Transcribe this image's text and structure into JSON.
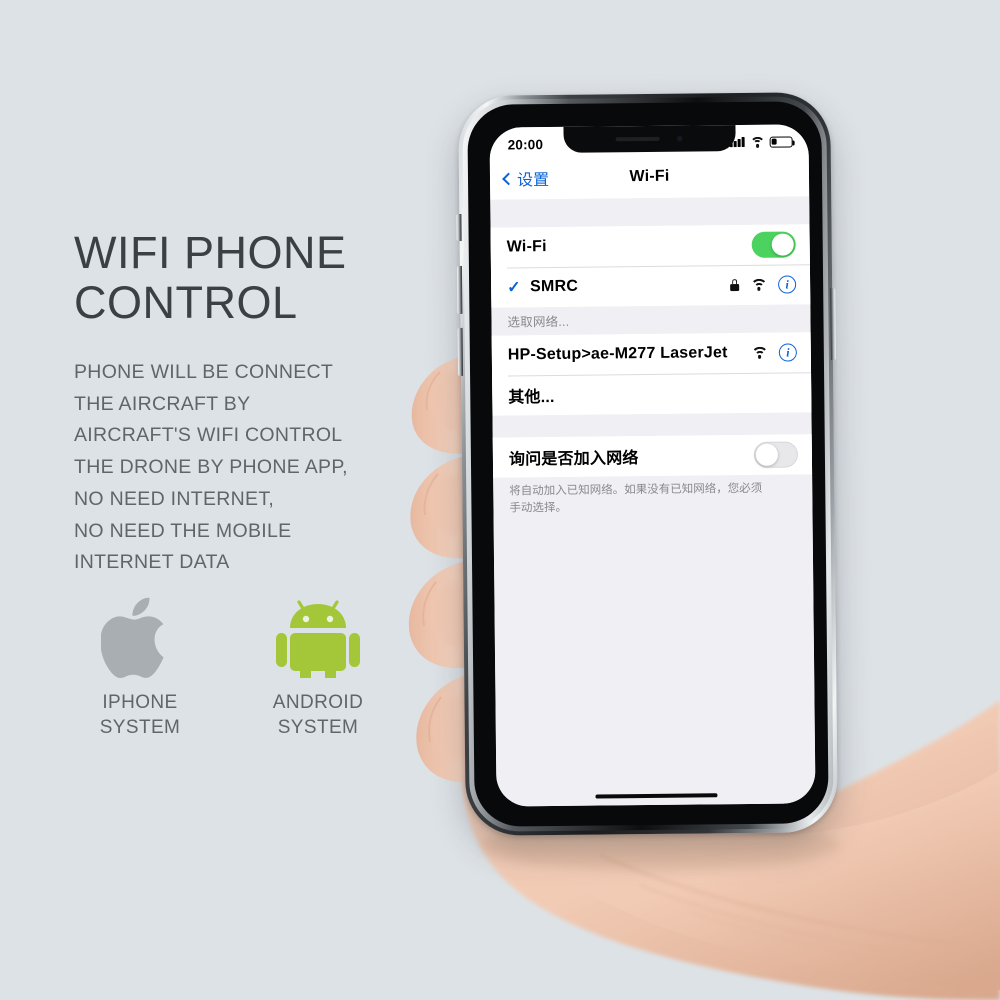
{
  "background_color": "#dde2e6",
  "marketing": {
    "headline": "WIFI PHONE\nCONTROL",
    "sub_copy": "PHONE WILL BE CONNECT\nTHE AIRCRAFT BY\n AIRCRAFT'S WIFI CONTROL\nTHE DRONE BY PHONE APP,\nNO NEED INTERNET,\nNO NEED THE MOBILE\nINTERNET DATA",
    "headline_color": "#3b4044",
    "body_color": "#5e666c"
  },
  "os_badges": [
    {
      "icon": "apple-logo-icon",
      "label": "IPHONE\nSYSTEM",
      "color": "#a9aeb2"
    },
    {
      "icon": "android-robot-icon",
      "label": "ANDROID\nSYSTEM",
      "color": "#a4c639"
    }
  ],
  "phone": {
    "status_bar": {
      "time": "20:00",
      "signal_icon": "cellular-signal-icon",
      "wifi_icon": "wifi-icon",
      "battery_icon": "battery-low-icon",
      "battery_level_percent": 26
    },
    "nav_bar": {
      "back_icon": "chevron-left-icon",
      "back_label": "设置",
      "title": "Wi-Fi"
    },
    "wifi_toggle_row": {
      "label": "Wi-Fi",
      "toggle_state": "on",
      "toggle_on_color": "#4cd25e"
    },
    "connected_network": {
      "check_icon": "checkmark-icon",
      "name": "SMRC",
      "lock_icon": "lock-icon",
      "signal_icon": "wifi-icon",
      "info_icon": "info-circle-icon"
    },
    "choose_network_header": "选取网络...",
    "available_networks": [
      {
        "name": "HP-Setup>ae-M277 LaserJet",
        "signal_icon": "wifi-icon",
        "info_icon": "info-circle-icon",
        "has_lock": false
      },
      {
        "name": "其他...",
        "has_icons": false
      }
    ],
    "ask_to_join": {
      "label": "询问是否加入网络",
      "toggle_state": "off",
      "footnote": "将自动加入已知网络。如果没有已知网络，您必须\n手动选择。"
    },
    "accent_color": "#0b62d6",
    "home_indicator": "home-indicator"
  }
}
